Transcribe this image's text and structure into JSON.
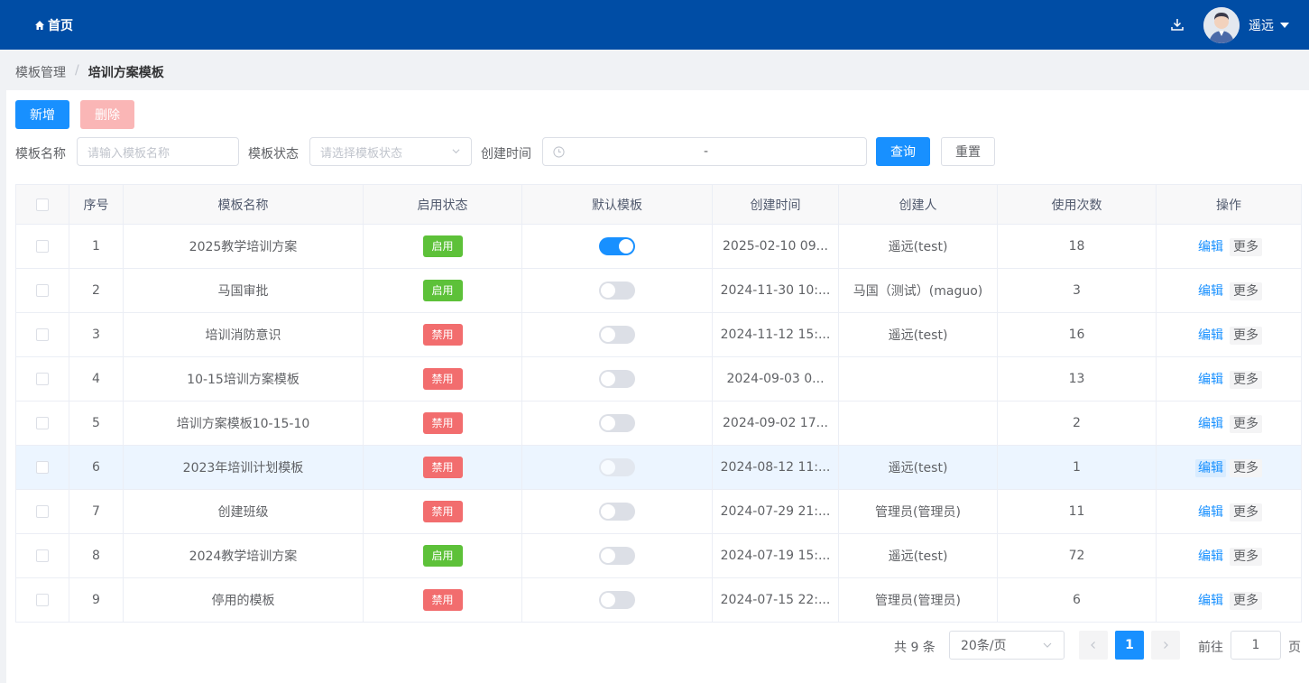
{
  "header": {
    "home_label": "首页",
    "user_name": "遥远",
    "brand_color": "#004da5"
  },
  "breadcrumb": {
    "parent": "模板管理",
    "separator": "/",
    "current": "培训方案模板"
  },
  "toolbar": {
    "add_label": "新增",
    "delete_label": "删除"
  },
  "filters": {
    "name_label": "模板名称",
    "name_placeholder": "请输入模板名称",
    "status_label": "模板状态",
    "status_placeholder": "请选择模板状态",
    "time_label": "创建时间",
    "time_separator": "-",
    "query_label": "查询",
    "reset_label": "重置"
  },
  "table": {
    "columns": [
      "序号",
      "模板名称",
      "启用状态",
      "默认模板",
      "创建时间",
      "创建人",
      "使用次数",
      "操作"
    ],
    "edit_label": "编辑",
    "more_label": "更多",
    "rows": [
      {
        "index": "1",
        "name": "2025教学培训方案",
        "status": "启用",
        "enabled": true,
        "default": true,
        "created": "2025-02-10 09...",
        "creator": "遥远(test)",
        "uses": "18"
      },
      {
        "index": "2",
        "name": "马国审批",
        "status": "启用",
        "enabled": true,
        "default": false,
        "created": "2024-11-30 10:...",
        "creator": "马国（测试）(maguo)",
        "uses": "3"
      },
      {
        "index": "3",
        "name": "培训消防意识",
        "status": "禁用",
        "enabled": false,
        "default": false,
        "created": "2024-11-12 15:...",
        "creator": "遥远(test)",
        "uses": "16"
      },
      {
        "index": "4",
        "name": "10-15培训方案模板",
        "status": "禁用",
        "enabled": false,
        "default": false,
        "created": "2024-09-03 0...",
        "creator": "",
        "uses": "13"
      },
      {
        "index": "5",
        "name": "培训方案模板10-15-10",
        "status": "禁用",
        "enabled": false,
        "default": false,
        "created": "2024-09-02 17...",
        "creator": "",
        "uses": "2"
      },
      {
        "index": "6",
        "name": "2023年培训计划模板",
        "status": "禁用",
        "enabled": false,
        "default": false,
        "created": "2024-08-12 11:...",
        "creator": "遥远(test)",
        "uses": "1",
        "highlighted": true
      },
      {
        "index": "7",
        "name": "创建班级",
        "status": "禁用",
        "enabled": false,
        "default": false,
        "created": "2024-07-29 21:...",
        "creator": "管理员(管理员)",
        "uses": "11"
      },
      {
        "index": "8",
        "name": "2024教学培训方案",
        "status": "启用",
        "enabled": true,
        "default": false,
        "created": "2024-07-19 15:...",
        "creator": "遥远(test)",
        "uses": "72"
      },
      {
        "index": "9",
        "name": "停用的模板",
        "status": "禁用",
        "enabled": false,
        "default": false,
        "created": "2024-07-15 22:...",
        "creator": "管理员(管理员)",
        "uses": "6"
      }
    ]
  },
  "pagination": {
    "total_text": "共 9 条",
    "page_size": "20条/页",
    "current_page": "1",
    "goto_label": "前往",
    "goto_value": "1",
    "page_suffix": "页"
  }
}
